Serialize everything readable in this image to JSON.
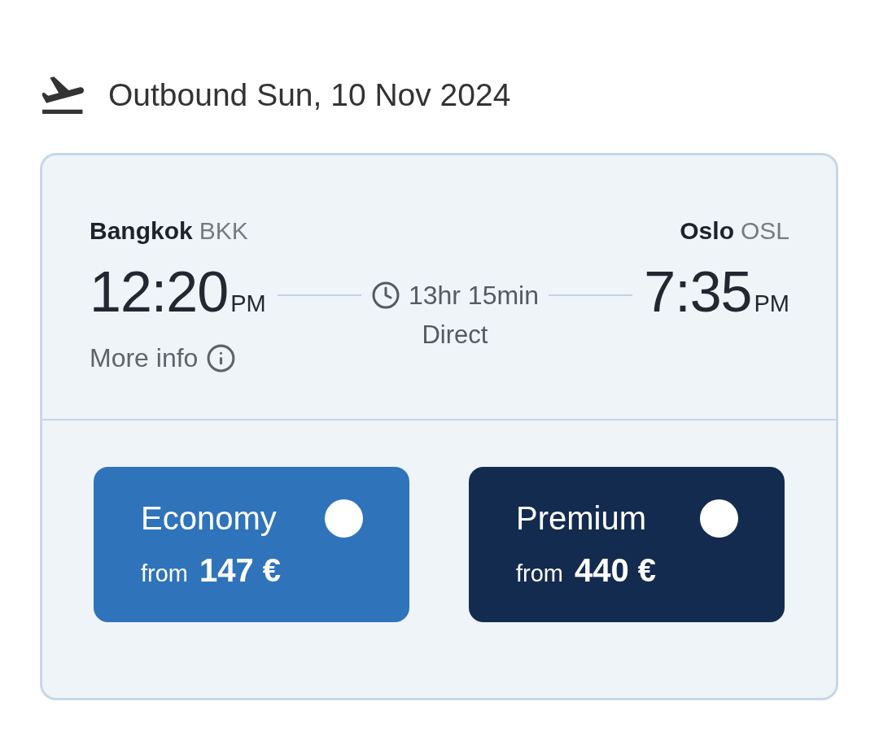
{
  "heading": {
    "label": "Outbound Sun, 10 Nov 2024"
  },
  "flight": {
    "origin": {
      "city": "Bangkok",
      "code": "BKK",
      "time": "12:20",
      "period": "PM"
    },
    "destination": {
      "city": "Oslo",
      "code": "OSL",
      "time": "7:35",
      "period": "PM"
    },
    "duration": "13hr 15min",
    "stops": "Direct",
    "more_info": "More info"
  },
  "fares": [
    {
      "name": "Economy",
      "prefix": "from",
      "price": "147 €",
      "color": "#2f73bb",
      "selected": false
    },
    {
      "name": "Premium",
      "prefix": "from",
      "price": "440 €",
      "color": "#132b4f",
      "selected": false
    }
  ]
}
